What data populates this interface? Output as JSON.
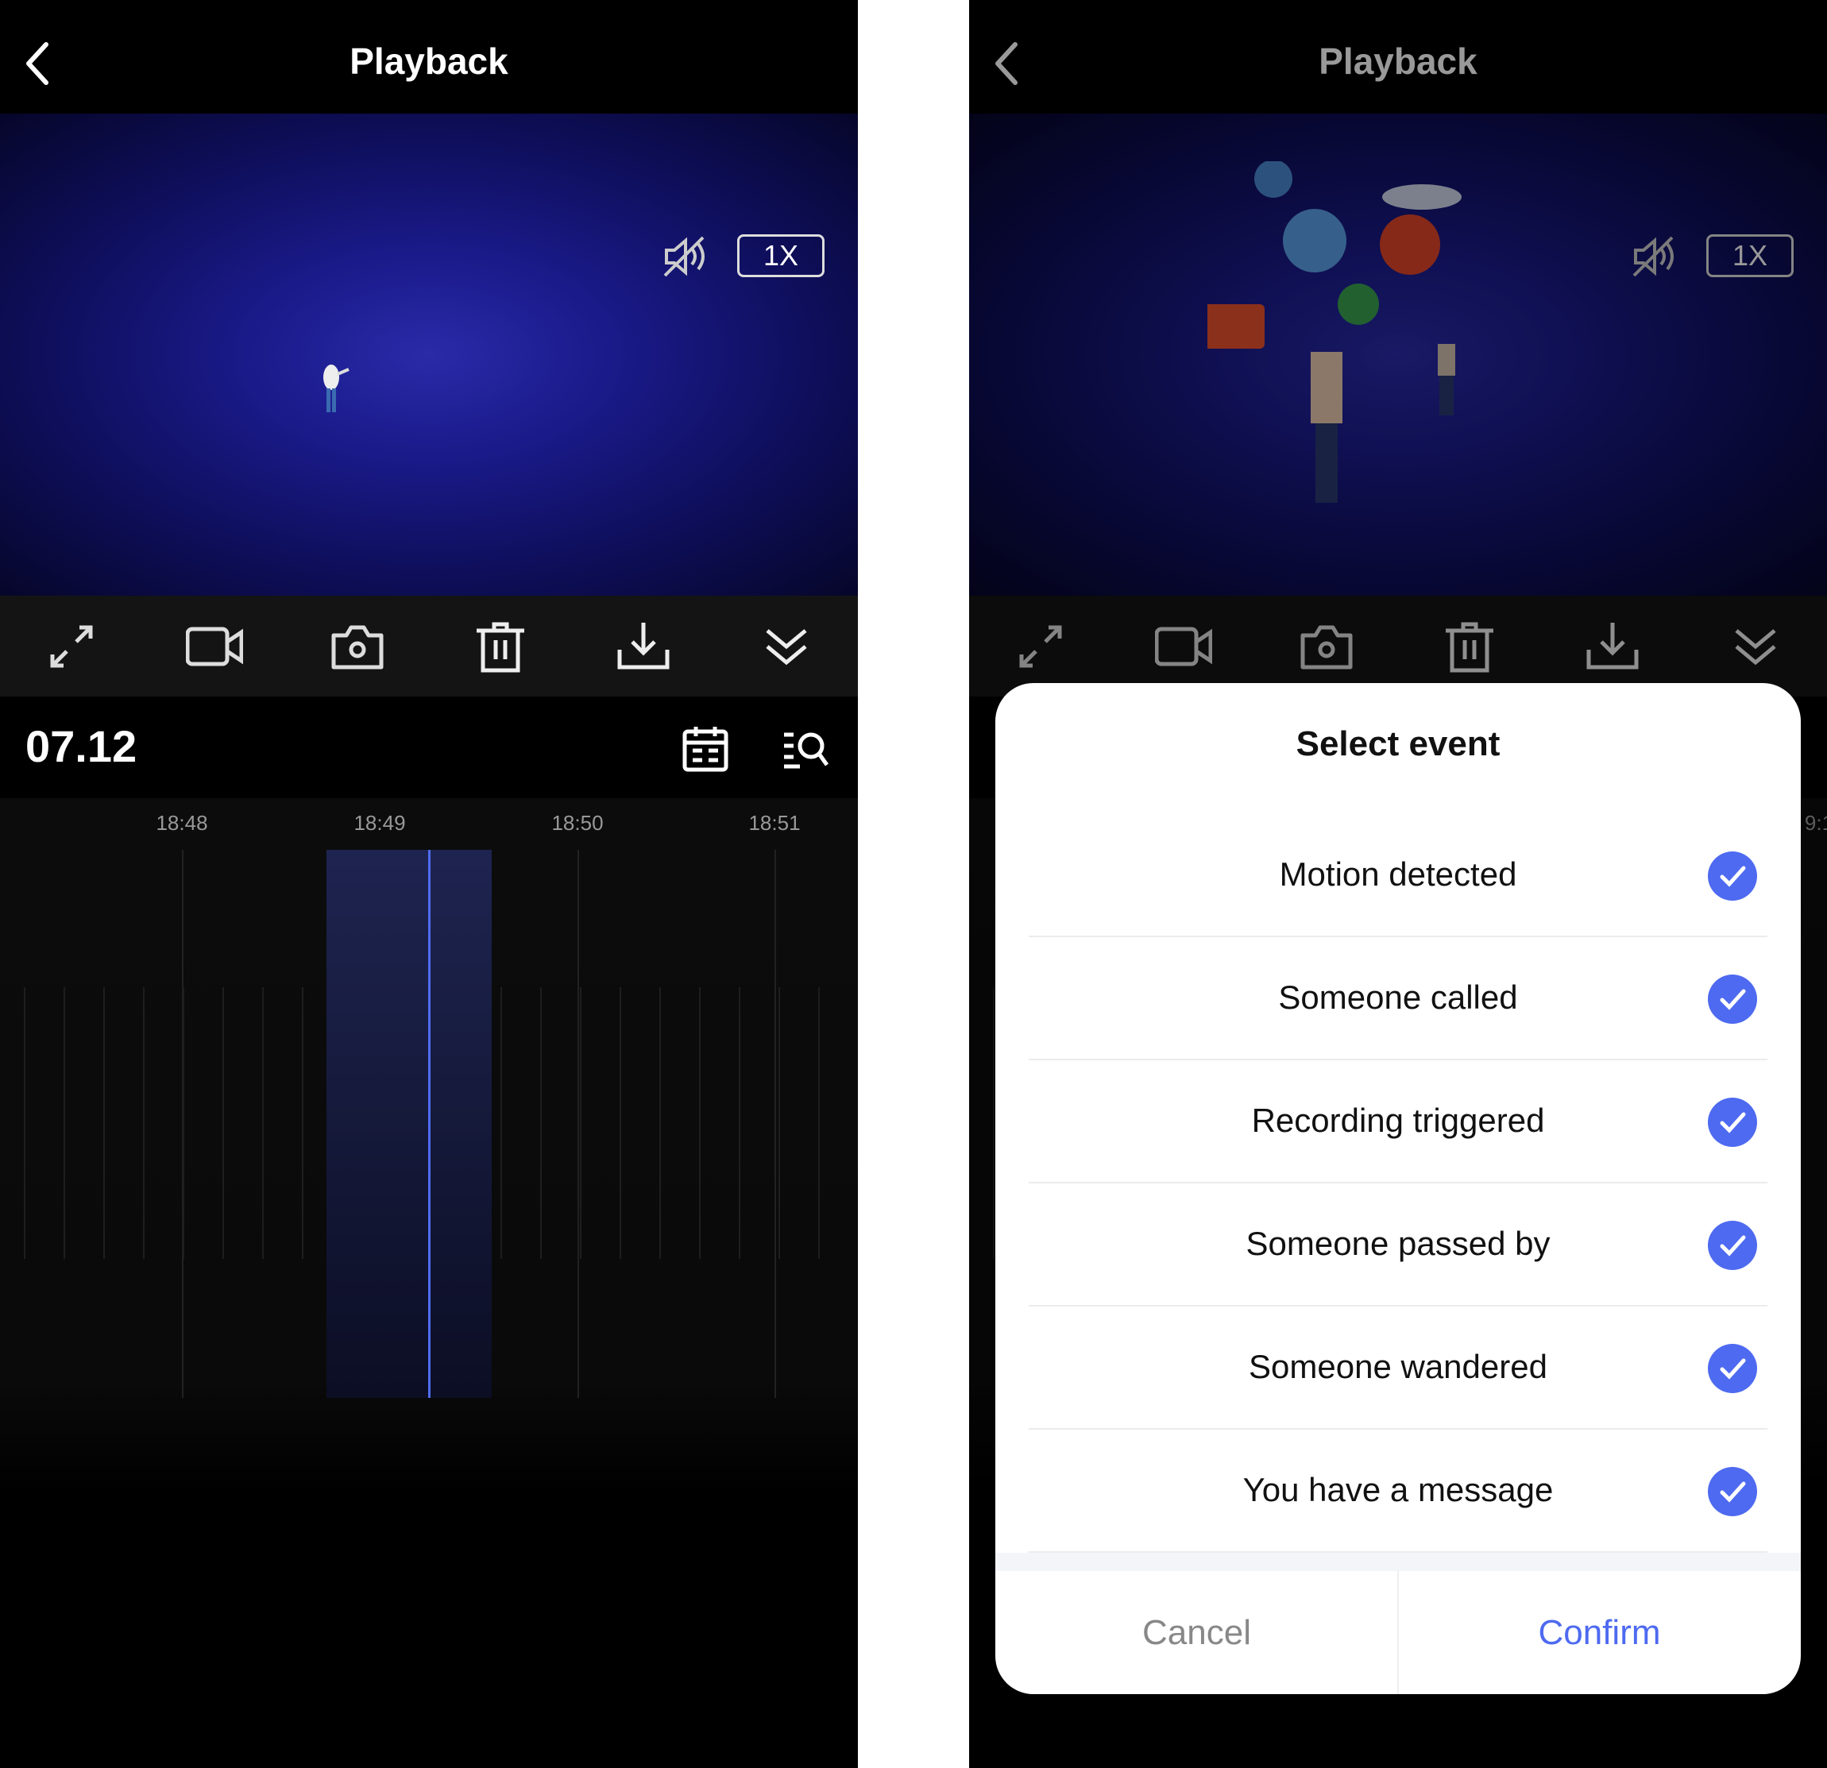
{
  "left": {
    "header": {
      "title": "Playback",
      "back_icon": "chevron-left-icon"
    },
    "video": {
      "speed": "1X",
      "audio_icon": "mute-icon"
    },
    "toolbar": [
      "fullscreen-icon",
      "record-video-icon",
      "snapshot-camera-icon",
      "delete-trash-icon",
      "download-icon",
      "collapse-chevrons-icon"
    ],
    "date": "07.12",
    "date_actions": [
      "calendar-icon",
      "event-search-icon"
    ],
    "timeline": {
      "labels": [
        "18:48",
        "18:49",
        "18:50",
        "18:51"
      ]
    }
  },
  "right": {
    "header": {
      "title": "Playback"
    },
    "video": {
      "speed": "1X"
    },
    "timeline_partial_label": "9:1",
    "modal": {
      "title": "Select event",
      "events": [
        {
          "label": "Motion detected",
          "checked": true
        },
        {
          "label": "Someone called",
          "checked": true
        },
        {
          "label": "Recording triggered",
          "checked": true
        },
        {
          "label": "Someone passed by",
          "checked": true
        },
        {
          "label": "Someone wandered",
          "checked": true
        },
        {
          "label": "You have a message",
          "checked": true
        }
      ],
      "cancel": "Cancel",
      "confirm": "Confirm"
    }
  },
  "colors": {
    "accent": "#4e6af0",
    "cancel_text": "#888888",
    "toolbar_bg": "#141414"
  }
}
